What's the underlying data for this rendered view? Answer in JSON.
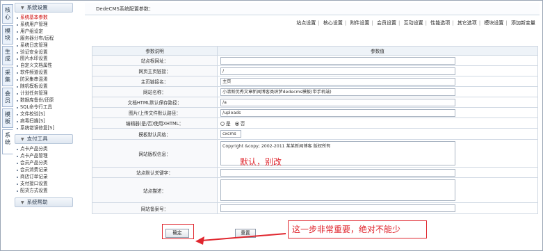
{
  "vtabs": [
    "核心",
    "模块",
    "生成",
    "采集",
    "会员",
    "模板",
    "系统"
  ],
  "sidebar": {
    "system_header": "系统设置",
    "system_items": [
      "系统基本参数",
      "系统用户管理",
      "用户组设定",
      "服务器分布/远程",
      "系统日志管理",
      "验证安全设置",
      "图片水印设置",
      "自定义文档属性",
      "软件频道设置",
      "防采集串混淆",
      "随机模板设置",
      "计划任务管理",
      "数据库备份/还原",
      "SQL命令行工具",
      "文件校验[S]",
      "病毒扫描[S]",
      "系统错误修复[S]"
    ],
    "pay_header": "支付工具",
    "pay_items": [
      "点卡产品分类",
      "点卡产品管理",
      "会员产品分类",
      "会员消费记录",
      "商店订单记录",
      "支付接口设置",
      "配货方式设置"
    ],
    "help_header": "系统帮助"
  },
  "main": {
    "title": "DedeCMS系统配置参数：",
    "tabs": [
      "站点设置",
      "核心设置",
      "附件设置",
      "会员设置",
      "互动设置",
      "性能选项",
      "其它选项",
      "模块设置",
      "添加新变量"
    ],
    "table_header": {
      "col1": "参数说明",
      "col2": "参数值"
    },
    "rows": {
      "site_url": {
        "label": "站点根网址：",
        "value": ""
      },
      "index_url": {
        "label": "网页主页链接：",
        "value": "/"
      },
      "index_name": {
        "label": "主页链接名：",
        "value": "主页"
      },
      "site_name": {
        "label": "网站名称：",
        "value": "小清新优秀文章新闻博客类织梦dedecms模板(带手机端)"
      },
      "html_path": {
        "label": "文档HTML默认保存路径：",
        "value": "/a"
      },
      "upload_path": {
        "label": "图片/上传文件默认路径：",
        "value": "/uploads"
      },
      "xhtml": {
        "label": "编辑器(是/否)使用XHTML：",
        "yes": "是",
        "no": "否"
      },
      "template": {
        "label": "模板默认风格：",
        "value": "cxcms"
      },
      "copyright": {
        "label": "网站版权信息：",
        "value": "Copyright &copy; 2002-2011 某某新闻博客 版权所有"
      },
      "keywords": {
        "label": "站点默认关键字：",
        "value": ""
      },
      "description": {
        "label": "站点描述：",
        "value": ""
      },
      "beian": {
        "label": "网站备案号：",
        "value": ""
      }
    },
    "confirm_label": "确定",
    "reset_label": "重置"
  },
  "annotations": {
    "template_note": "默认，别改",
    "confirm_note": "这一步非常重要，绝对不能少"
  },
  "colors": {
    "annotation": "#e0262e",
    "current_menu": "#cc0000"
  }
}
